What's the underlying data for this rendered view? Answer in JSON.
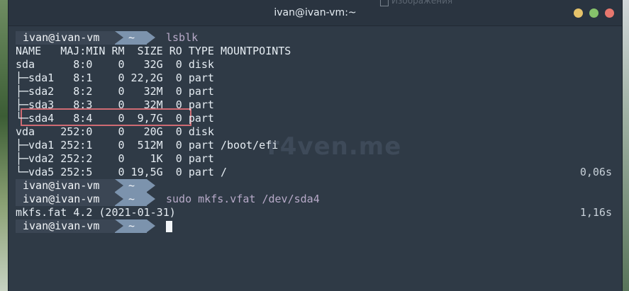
{
  "window": {
    "title": "ivan@ivan-vm:~",
    "background_hint": "Изображения"
  },
  "prompt": {
    "user": "ivan@ivan-vm",
    "dir": "~"
  },
  "colors": {
    "terminal_bg": "#2f3a46",
    "prompt_user_bg": "#3b4654",
    "prompt_dir_bg": "#7c93ad",
    "command": "#b7aac8",
    "highlight_box": "#cf6b73",
    "close": "#e7776e",
    "minimize": "#e6c36a",
    "maximize": "#86c26b"
  },
  "watermark": "r4ven.me",
  "lines": [
    {
      "type": "prompt",
      "cmd": "lsblk"
    },
    {
      "type": "out",
      "text": "NAME   MAJ:MIN RM  SIZE RO TYPE MOUNTPOINTS"
    },
    {
      "type": "out",
      "text": "sda      8:0    0   32G  0 disk"
    },
    {
      "type": "out",
      "text": "├─sda1   8:1    0 22,2G  0 part"
    },
    {
      "type": "out",
      "text": "├─sda2   8:2    0   32M  0 part"
    },
    {
      "type": "out",
      "text": "├─sda3   8:3    0   32M  0 part"
    },
    {
      "type": "out",
      "text": "└─sda4   8:4    0  9,7G  0 part"
    },
    {
      "type": "out",
      "text": "vda    252:0    0   20G  0 disk"
    },
    {
      "type": "out",
      "text": "├─vda1 252:1    0  512M  0 part /boot/efi"
    },
    {
      "type": "out",
      "text": "├─vda2 252:2    0    1K  0 part"
    },
    {
      "type": "out",
      "text": "└─vda5 252:5    0 19,5G  0 part /",
      "time": "0,06s"
    },
    {
      "type": "prompt",
      "cmd": ""
    },
    {
      "type": "prompt",
      "cmd": "sudo mkfs.vfat /dev/sda4"
    },
    {
      "type": "out",
      "text": "mkfs.fat 4.2 (2021-01-31)",
      "time": "1,16s"
    },
    {
      "type": "prompt",
      "cmd": "",
      "cursor": true
    }
  ]
}
